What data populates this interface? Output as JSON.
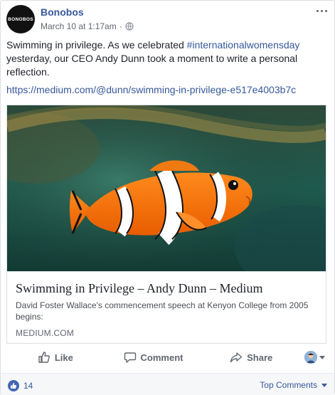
{
  "post": {
    "page_name": "Bonobos",
    "avatar_text": "BONOBOS",
    "timestamp": "March 10 at 1:17am",
    "separator": "·",
    "text_before": "Swimming in privilege. As we celebrated ",
    "hashtag": "#internationalwomensday",
    "text_after": " yesterday, our CEO Andy Dunn took a moment to write a personal reflection.",
    "link": "https://medium.com/@dunn/swimming-in-privilege-e517e4003b7c"
  },
  "attachment": {
    "image": "clownfish-photo",
    "title": "Swimming in Privilege – Andy Dunn – Medium",
    "description": "David Foster Wallace's commencement speech at Kenyon College from 2005 begins:",
    "domain": "MEDIUM.COM"
  },
  "actions": {
    "like": "Like",
    "comment": "Comment",
    "share": "Share"
  },
  "footer": {
    "reaction_count": "14",
    "sort_label": "Top Comments"
  },
  "colors": {
    "link": "#365899",
    "muted": "#616770",
    "like_blue": "#4267b2",
    "footer_bg": "#f6f7f9"
  },
  "icons": [
    "globe-icon",
    "more-options-icon",
    "like-icon",
    "comment-icon",
    "share-icon",
    "chevron-down-icon",
    "like-reaction-icon"
  ]
}
